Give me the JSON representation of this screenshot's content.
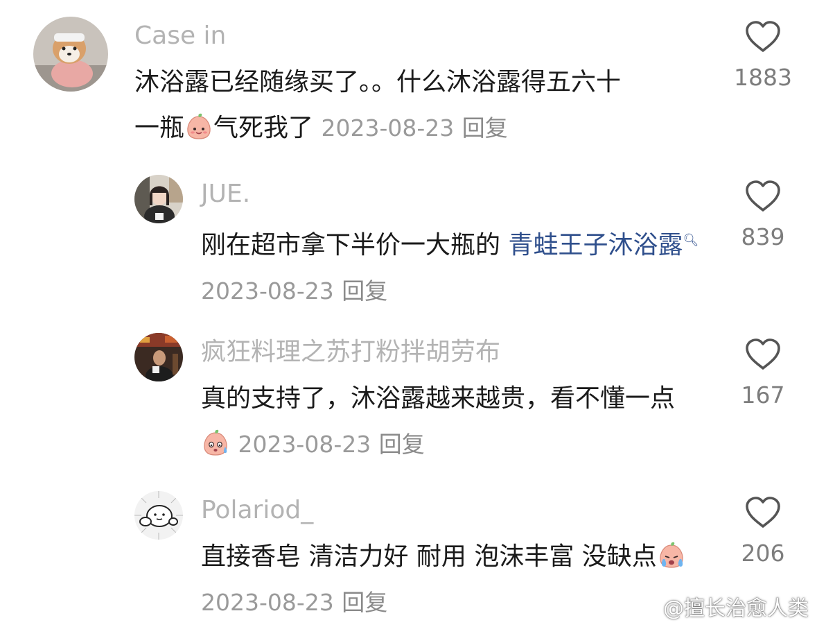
{
  "comments": [
    {
      "username": "Case in",
      "text_before": "沐浴露已经随缘买了。。什么沐浴露得五六十一瓶",
      "text_after": "气死我了",
      "date": "2023-08-23",
      "reply": "回复",
      "likes": "1883",
      "emoji": "peach-smile-emoji"
    },
    {
      "username": "JUE.",
      "text_before": "刚在超市拿下半价一大瓶的 ",
      "link": "青蛙王子沐浴露",
      "date": "2023-08-23",
      "reply": "回复",
      "likes": "839"
    },
    {
      "username": "疯狂料理之苏打粉拌胡劳布",
      "text_before": "真的支持了，沐浴露越来越贵，看不懂一点",
      "date": "2023-08-23",
      "reply": "回复",
      "likes": "167",
      "emoji": "peach-sweat-emoji"
    },
    {
      "username": "Polariod_",
      "text_before": "直接香皂 清洁力好 耐用 泡沫丰富 没缺点",
      "date": "2023-08-23",
      "reply": "回复",
      "likes": "206",
      "emoji": "peach-cry-emoji"
    }
  ],
  "watermark": "@擅长治愈人类",
  "colors": {
    "username": "#b3b3b3",
    "link": "#2f4f8c",
    "meta": "#9a9a9a",
    "heart": "#555555"
  }
}
